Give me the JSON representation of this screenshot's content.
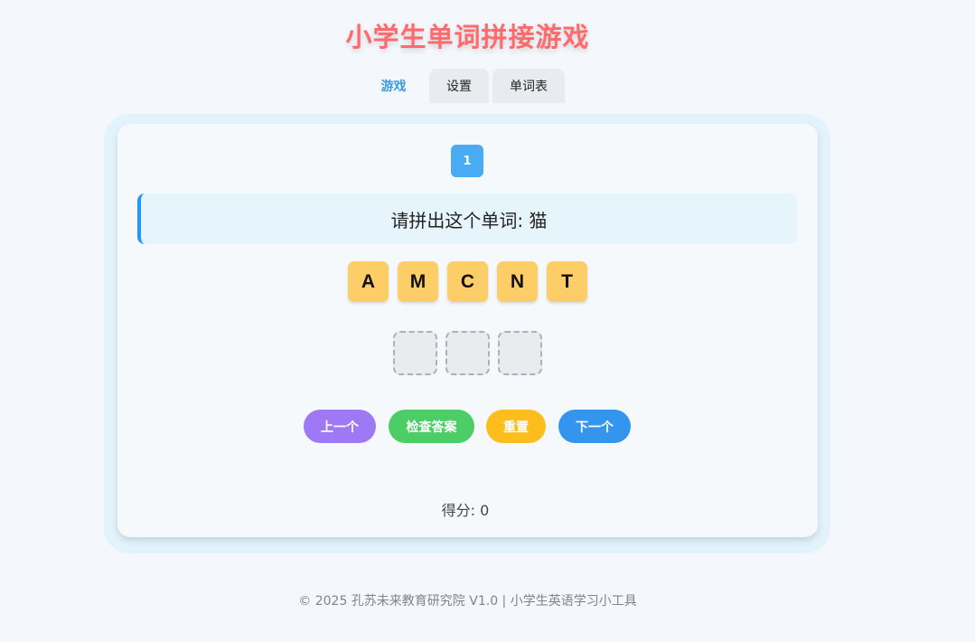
{
  "header": {
    "title": "小学生单词拼接游戏"
  },
  "tabs": [
    {
      "label": "游戏",
      "active": true
    },
    {
      "label": "设置",
      "active": false
    },
    {
      "label": "单词表",
      "active": false
    }
  ],
  "game": {
    "level": "1",
    "prompt": "请拼出这个单词: 猫",
    "letters": [
      "A",
      "M",
      "C",
      "N",
      "T"
    ],
    "slot_count": 3,
    "buttons": {
      "prev": "上一个",
      "check": "检查答案",
      "reset": "重置",
      "next": "下一个"
    },
    "score": "得分: 0"
  },
  "footer": {
    "text": "© 2025 孔苏未来教育研究院 V1.0 | 小学生英语学习小工具"
  },
  "colors": {
    "title": "#ff6b6b",
    "accent_blue": "#2196f3",
    "letter_tile": "#fdcd67",
    "prev_button": "#9f78f5",
    "check_button": "#4ccd66",
    "reset_button": "#fdbd1c",
    "next_button": "#3395ee"
  }
}
